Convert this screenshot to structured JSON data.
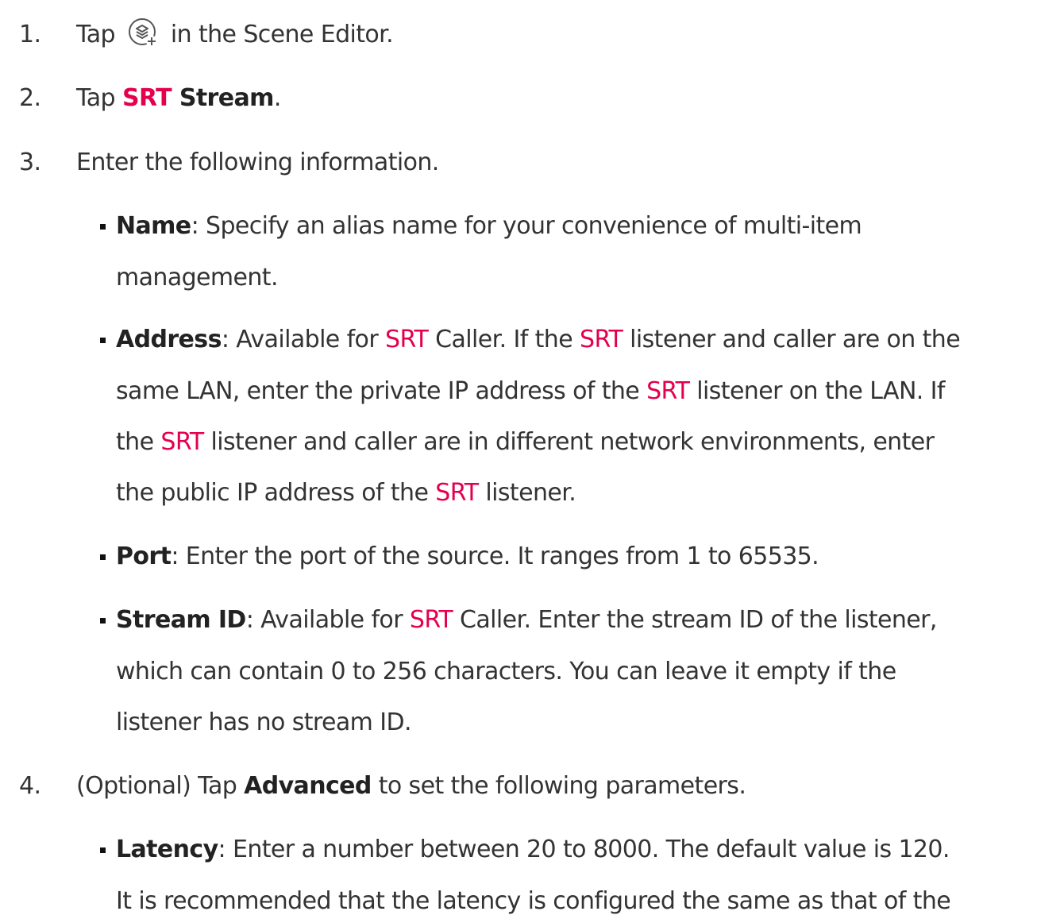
{
  "steps": [
    {
      "num": "1.",
      "pre": "Tap",
      "post": "in the Scene Editor.",
      "icon": "add-layer-icon"
    },
    {
      "num": "2.",
      "pre": "Tap ",
      "srt": "SRT",
      "bold": " Stream",
      "post": "."
    },
    {
      "num": "3.",
      "text": "Enter the following information."
    },
    {
      "num": "4.",
      "pre": "(Optional) Tap ",
      "bold": "Advanced",
      "post": " to set the following parameters."
    }
  ],
  "name_item": {
    "term": "Name",
    "line1": ": Specify an alias name for your convenience of multi-item",
    "line2": "management."
  },
  "address_item": {
    "term": "Address",
    "l1a": ": Available for ",
    "l1b": " Caller. If the ",
    "l1c": " listener and caller are on the",
    "l2a": "same LAN, enter the private IP address of the ",
    "l2b": " listener on the LAN. If",
    "l3a": "the ",
    "l3b": " listener and caller are in different network environments, enter",
    "l4a": "the public IP address of the ",
    "l4b": " listener."
  },
  "port_item": {
    "term": "Port",
    "text": ": Enter the port of the source. It ranges from 1 to 65535."
  },
  "streamid_item": {
    "term": "Stream ID",
    "l1a": ": Available for ",
    "l1b": " Caller. Enter the stream ID of the listener,",
    "line2": "which can contain 0 to 256 characters. You can leave it empty if the",
    "line3": "listener has no stream ID."
  },
  "latency_item": {
    "term": "Latency",
    "line1": ": Enter a number between 20 to 8000. The default value is 120.",
    "line2": "It is recommended that the latency is configured the same as that of the"
  },
  "srt_label": "SRT",
  "colors": {
    "text": "#333333",
    "accent": "#e4004f",
    "bullet": "#111111"
  }
}
